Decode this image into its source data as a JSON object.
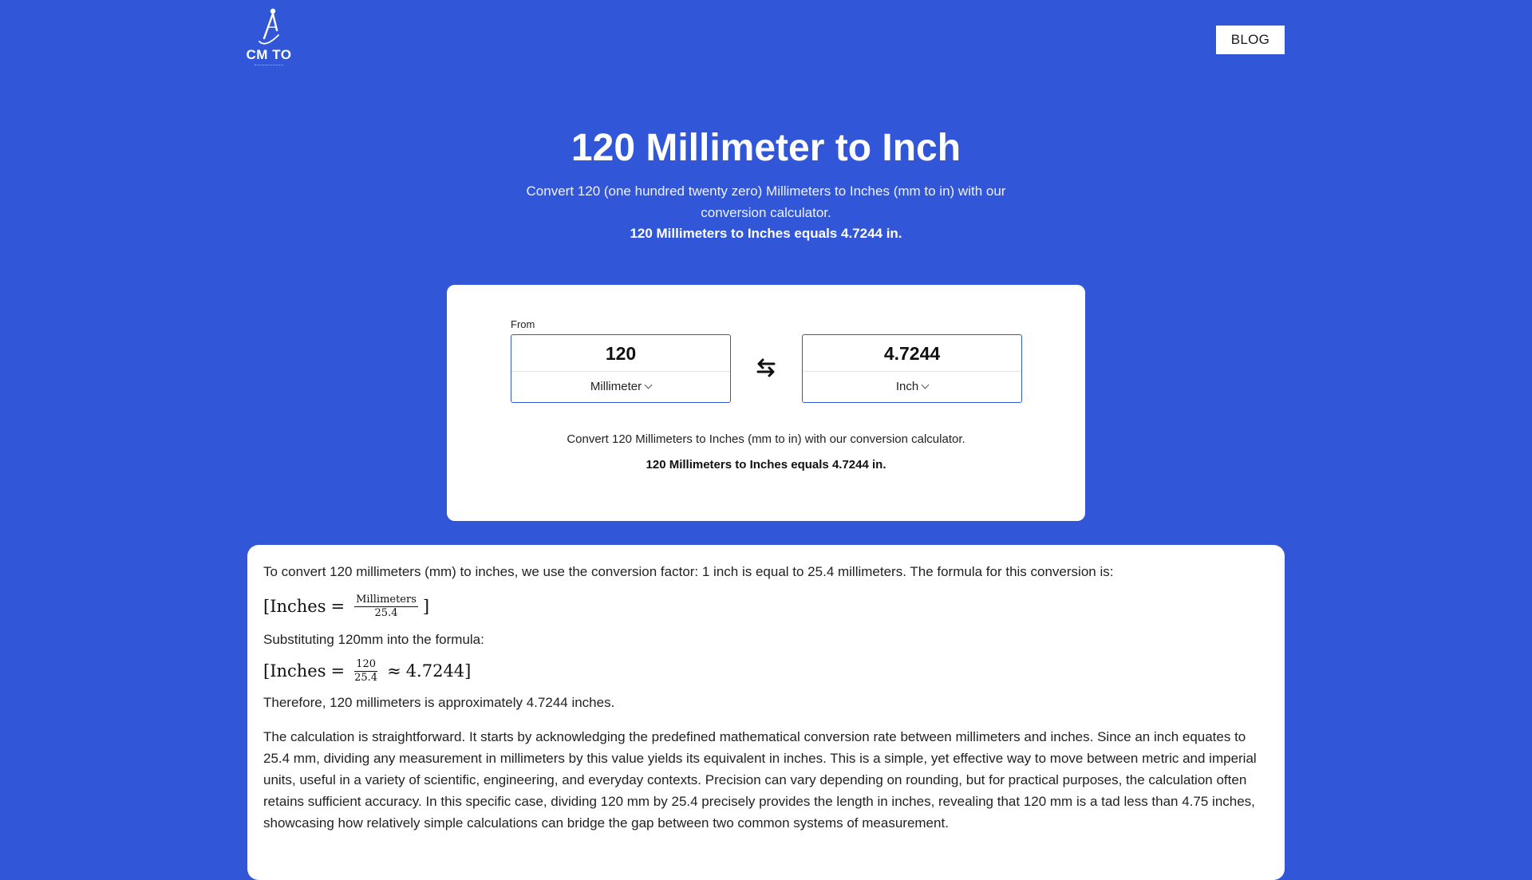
{
  "header": {
    "logo_text": "CM TO",
    "blog_label": "BLOG"
  },
  "hero": {
    "title": "120 Millimeter to Inch",
    "description": "Convert 120 (one hundred twenty zero) Millimeters to Inches (mm to in) with our conversion calculator.",
    "result": "120 Millimeters to Inches equals 4.7244 in."
  },
  "converter": {
    "from_label": "From",
    "from_value": "120",
    "from_unit": "Millimeter",
    "to_value": "4.7244",
    "to_unit": "Inch",
    "description": "Convert 120 Millimeters to Inches (mm to in) with our conversion calculator.",
    "result": "120 Millimeters to Inches equals 4.7244 in."
  },
  "article": {
    "intro": "To convert 120 millimeters (mm) to inches, we use the conversion factor: 1 inch is equal to 25.4 millimeters. The formula for this conversion is:",
    "formula1": {
      "open": "[",
      "lhs": "Inches",
      "eq": "=",
      "numerator": "Millimeters",
      "denominator": "25.4",
      "close": "]"
    },
    "substituting": "Substituting 120mm into the formula:",
    "formula2": {
      "open": "[",
      "lhs": "Inches",
      "eq": "=",
      "numerator": "120",
      "denominator": "25.4",
      "approx": "≈",
      "result": "4.7244",
      "close": "]"
    },
    "therefore": "Therefore, 120 millimeters is approximately 4.7244 inches.",
    "explanation": "The calculation is straightforward. It starts by acknowledging the predefined mathematical conversion rate between millimeters and inches. Since an inch equates to 25.4 mm, dividing any measurement in millimeters by this value yields its equivalent in inches. This is a simple, yet effective way to move between metric and imperial units, useful in a variety of scientific, engineering, and everyday contexts. Precision can vary depending on rounding, but for practical purposes, the calculation often retains sufficient accuracy. In this specific case, dividing 120 mm by 25.4 precisely provides the length in inches, revealing that 120 mm is a tad less than 4.75 inches, showcasing how relatively simple calculations can bridge the gap between two common systems of measurement."
  },
  "icons": {
    "logo": "compass-icon",
    "swap": "swap-arrows-icon",
    "dropdown": "chevron-down-icon"
  },
  "colors": {
    "background": "#3157d8",
    "card": "#ffffff",
    "input_border": "#3157d8"
  }
}
